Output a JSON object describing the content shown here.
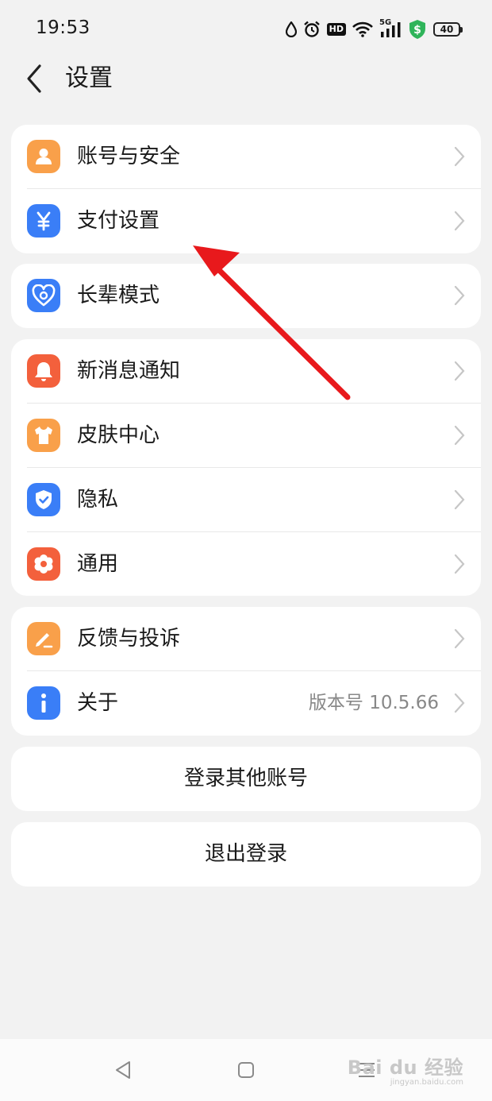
{
  "status_bar": {
    "time": "19:53",
    "network": "5G",
    "hd": "HD",
    "battery": "40"
  },
  "header": {
    "title": "设置"
  },
  "groups": [
    {
      "items": [
        {
          "label": "账号与安全",
          "icon": "user-icon",
          "color": "#f9a04a"
        },
        {
          "label": "支付设置",
          "icon": "yuan-icon",
          "color": "#3a7ef7"
        }
      ]
    },
    {
      "items": [
        {
          "label": "长辈模式",
          "icon": "heart-icon",
          "color": "#3a7ef7"
        }
      ]
    },
    {
      "items": [
        {
          "label": "新消息通知",
          "icon": "bell-icon",
          "color": "#f3603c"
        },
        {
          "label": "皮肤中心",
          "icon": "shirt-icon",
          "color": "#f9a04a"
        },
        {
          "label": "隐私",
          "icon": "shield-icon",
          "color": "#3a7ef7"
        },
        {
          "label": "通用",
          "icon": "gear-icon",
          "color": "#f3603c"
        }
      ]
    },
    {
      "items": [
        {
          "label": "反馈与投诉",
          "icon": "pencil-icon",
          "color": "#f9a04a"
        },
        {
          "label": "关于",
          "icon": "info-icon",
          "color": "#3a7ef7",
          "value": "版本号 10.5.66"
        }
      ]
    }
  ],
  "actions": {
    "switch_account": "登录其他账号",
    "logout": "退出登录"
  },
  "watermark": {
    "main": "Bai du 经验",
    "sub": "jingyan.baidu.com"
  }
}
